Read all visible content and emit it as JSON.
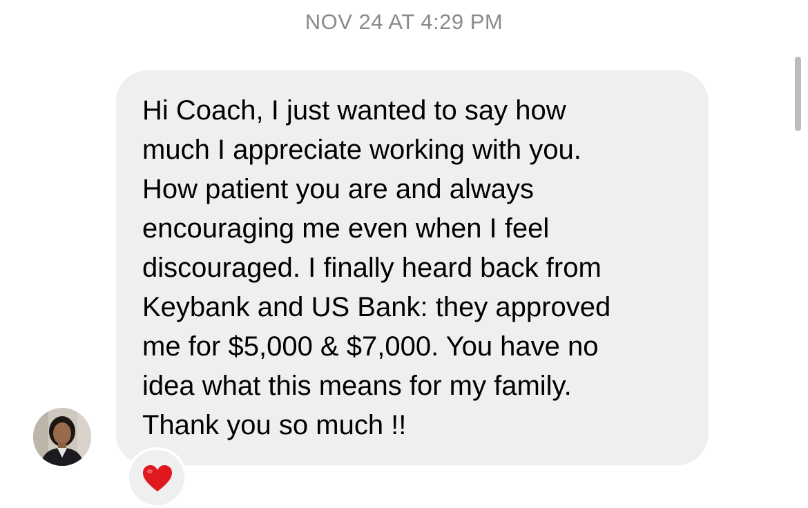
{
  "conversation": {
    "timestamp": "NOV 24 AT 4:29 PM",
    "message": {
      "text": "Hi Coach, I just wanted to say how\nmuch I appreciate working with you.\nHow patient you are and always\nencouraging me even when I feel\ndiscouraged. I finally heard back from\nKeybank and US Bank: they approved\nme for $5,000 & $7,000. You have no\nidea what this means for my family.\nThank you so much !!",
      "bubble_color": "#efeff0",
      "text_color": "#000000"
    },
    "sender": {
      "avatar_icon": "profile-photo"
    },
    "reaction": {
      "icon": "red-heart-icon",
      "color": "#e0191e"
    }
  }
}
